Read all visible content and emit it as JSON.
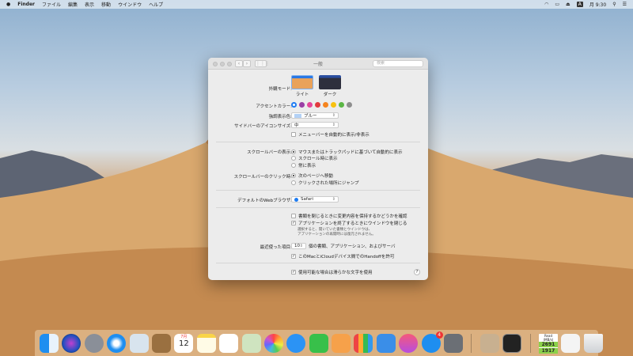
{
  "menubar": {
    "apple": "",
    "app": "Finder",
    "items": [
      "ファイル",
      "編集",
      "表示",
      "移動",
      "ウインドウ",
      "ヘルプ"
    ],
    "input": "A",
    "clock": "月 9:30"
  },
  "window": {
    "title": "一般",
    "search_placeholder": "検索",
    "appearance": {
      "label": "外観モード:",
      "options": [
        "ライト",
        "ダーク"
      ],
      "selected": "ライト"
    },
    "accent": {
      "label": "アクセントカラー:",
      "colors": [
        "#1e7cf2",
        "#9a3fa5",
        "#e5479a",
        "#e13b3f",
        "#f5841f",
        "#f8c10f",
        "#5bb645",
        "#8e8e8e"
      ],
      "selected": 0
    },
    "highlight": {
      "label": "強調表示色:",
      "value": "ブルー",
      "swatch": "#b3d1f5"
    },
    "sidebar_icon": {
      "label": "サイドバーのアイコンサイズ:",
      "value": "中"
    },
    "menubar_autohide": {
      "label": "メニューバーを自動的に表示/非表示",
      "checked": false
    },
    "scrollbars": {
      "label": "スクロールバーの表示:",
      "options": [
        "マウスまたはトラックパッドに基づいて自動的に表示",
        "スクロール時に表示",
        "常に表示"
      ],
      "selected": 0
    },
    "scroll_click": {
      "label": "スクロールバーのクリック時:",
      "options": [
        "次のページへ移動",
        "クリックされた場所にジャンプ"
      ],
      "selected": 0
    },
    "browser": {
      "label": "デフォルトのWebブラウザ:",
      "value": "Safari"
    },
    "ask_keep": {
      "label": "書類を閉じるときに変更内容を保持するかどうかを確認",
      "checked": false
    },
    "close_windows": {
      "label": "アプリケーションを終了するときにウインドウを閉じる",
      "checked": true,
      "note1": "選択すると、開いていた書類とウインドウは、",
      "note2": "アプリケーションの再開時には復元されません。"
    },
    "recent": {
      "label": "最近使った項目:",
      "value": "10",
      "suffix": "個の書類、アプリケーション、およびサーバ"
    },
    "handoff": {
      "label": "このMacとiCloudデバイス間でのHandoffを許可",
      "checked": true
    },
    "font_smoothing": {
      "label": "使用可能な場合は滑らかな文字を使用",
      "checked": true
    },
    "help": "?"
  },
  "dock": {
    "calendar_month": "7月",
    "calendar_day": "12",
    "appstore_badge": "4",
    "disk_label": "Read (MB/s)",
    "disk_read": "2691",
    "disk_write": "1917"
  }
}
